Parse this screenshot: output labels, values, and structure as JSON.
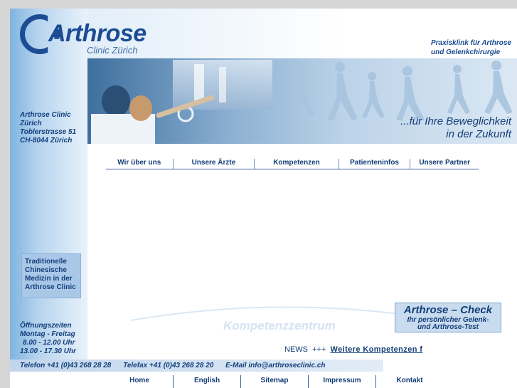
{
  "brand": {
    "title": "Arthrose",
    "subtitle": "Clinic Zürich",
    "tagline": [
      "Praxisklink für Arthrose",
      "und Gelenkchirurgie"
    ]
  },
  "banner": {
    "slogan": [
      "...für Ihre Beweglichkeit",
      "in der Zukunft"
    ]
  },
  "address": [
    "Arthrose Clinic",
    "Zürich",
    "Toblerstrasse 51",
    "CH-8044 Zürich"
  ],
  "main_nav": [
    {
      "label": "Wir über uns"
    },
    {
      "label": "Unsere Ärzte"
    },
    {
      "label": "Kompetenzen"
    },
    {
      "label": "Patienteninfos"
    },
    {
      "label": "Unsere Partner"
    }
  ],
  "tcm": [
    "Traditionelle",
    "Chinesische",
    "Medizin in der",
    "Arthrose Clinic"
  ],
  "hours": [
    "Öffnungszeiten",
    "Montag - Freitag",
    "8.00 - 12.00 Uhr",
    "13.00 - 17.30 Uhr"
  ],
  "watermark": "Kompetenzzentrum",
  "check": {
    "title": "Arthrose – Check",
    "subtitle": [
      "Ihr persönlicher Gelenk-",
      "und Arthrose-Test"
    ]
  },
  "news": {
    "prefix": "NEWS",
    "separator": "+++",
    "link": "Weitere Kompetenzen f"
  },
  "contact": {
    "phone": "Telefon  +41 (0)43 268 28 28",
    "fax": "Telefax  +41 (0)43 268 28 20",
    "email": "E-Mail  info@arthroseclinic.ch"
  },
  "footer_nav": [
    {
      "label": "Home"
    },
    {
      "label": "English"
    },
    {
      "label": "Sitemap"
    },
    {
      "label": "Impressum"
    },
    {
      "label": "Kontakt"
    }
  ],
  "colors": {
    "brand": "#1b4c94",
    "text": "#123d77",
    "background": "#d6d6d6"
  }
}
